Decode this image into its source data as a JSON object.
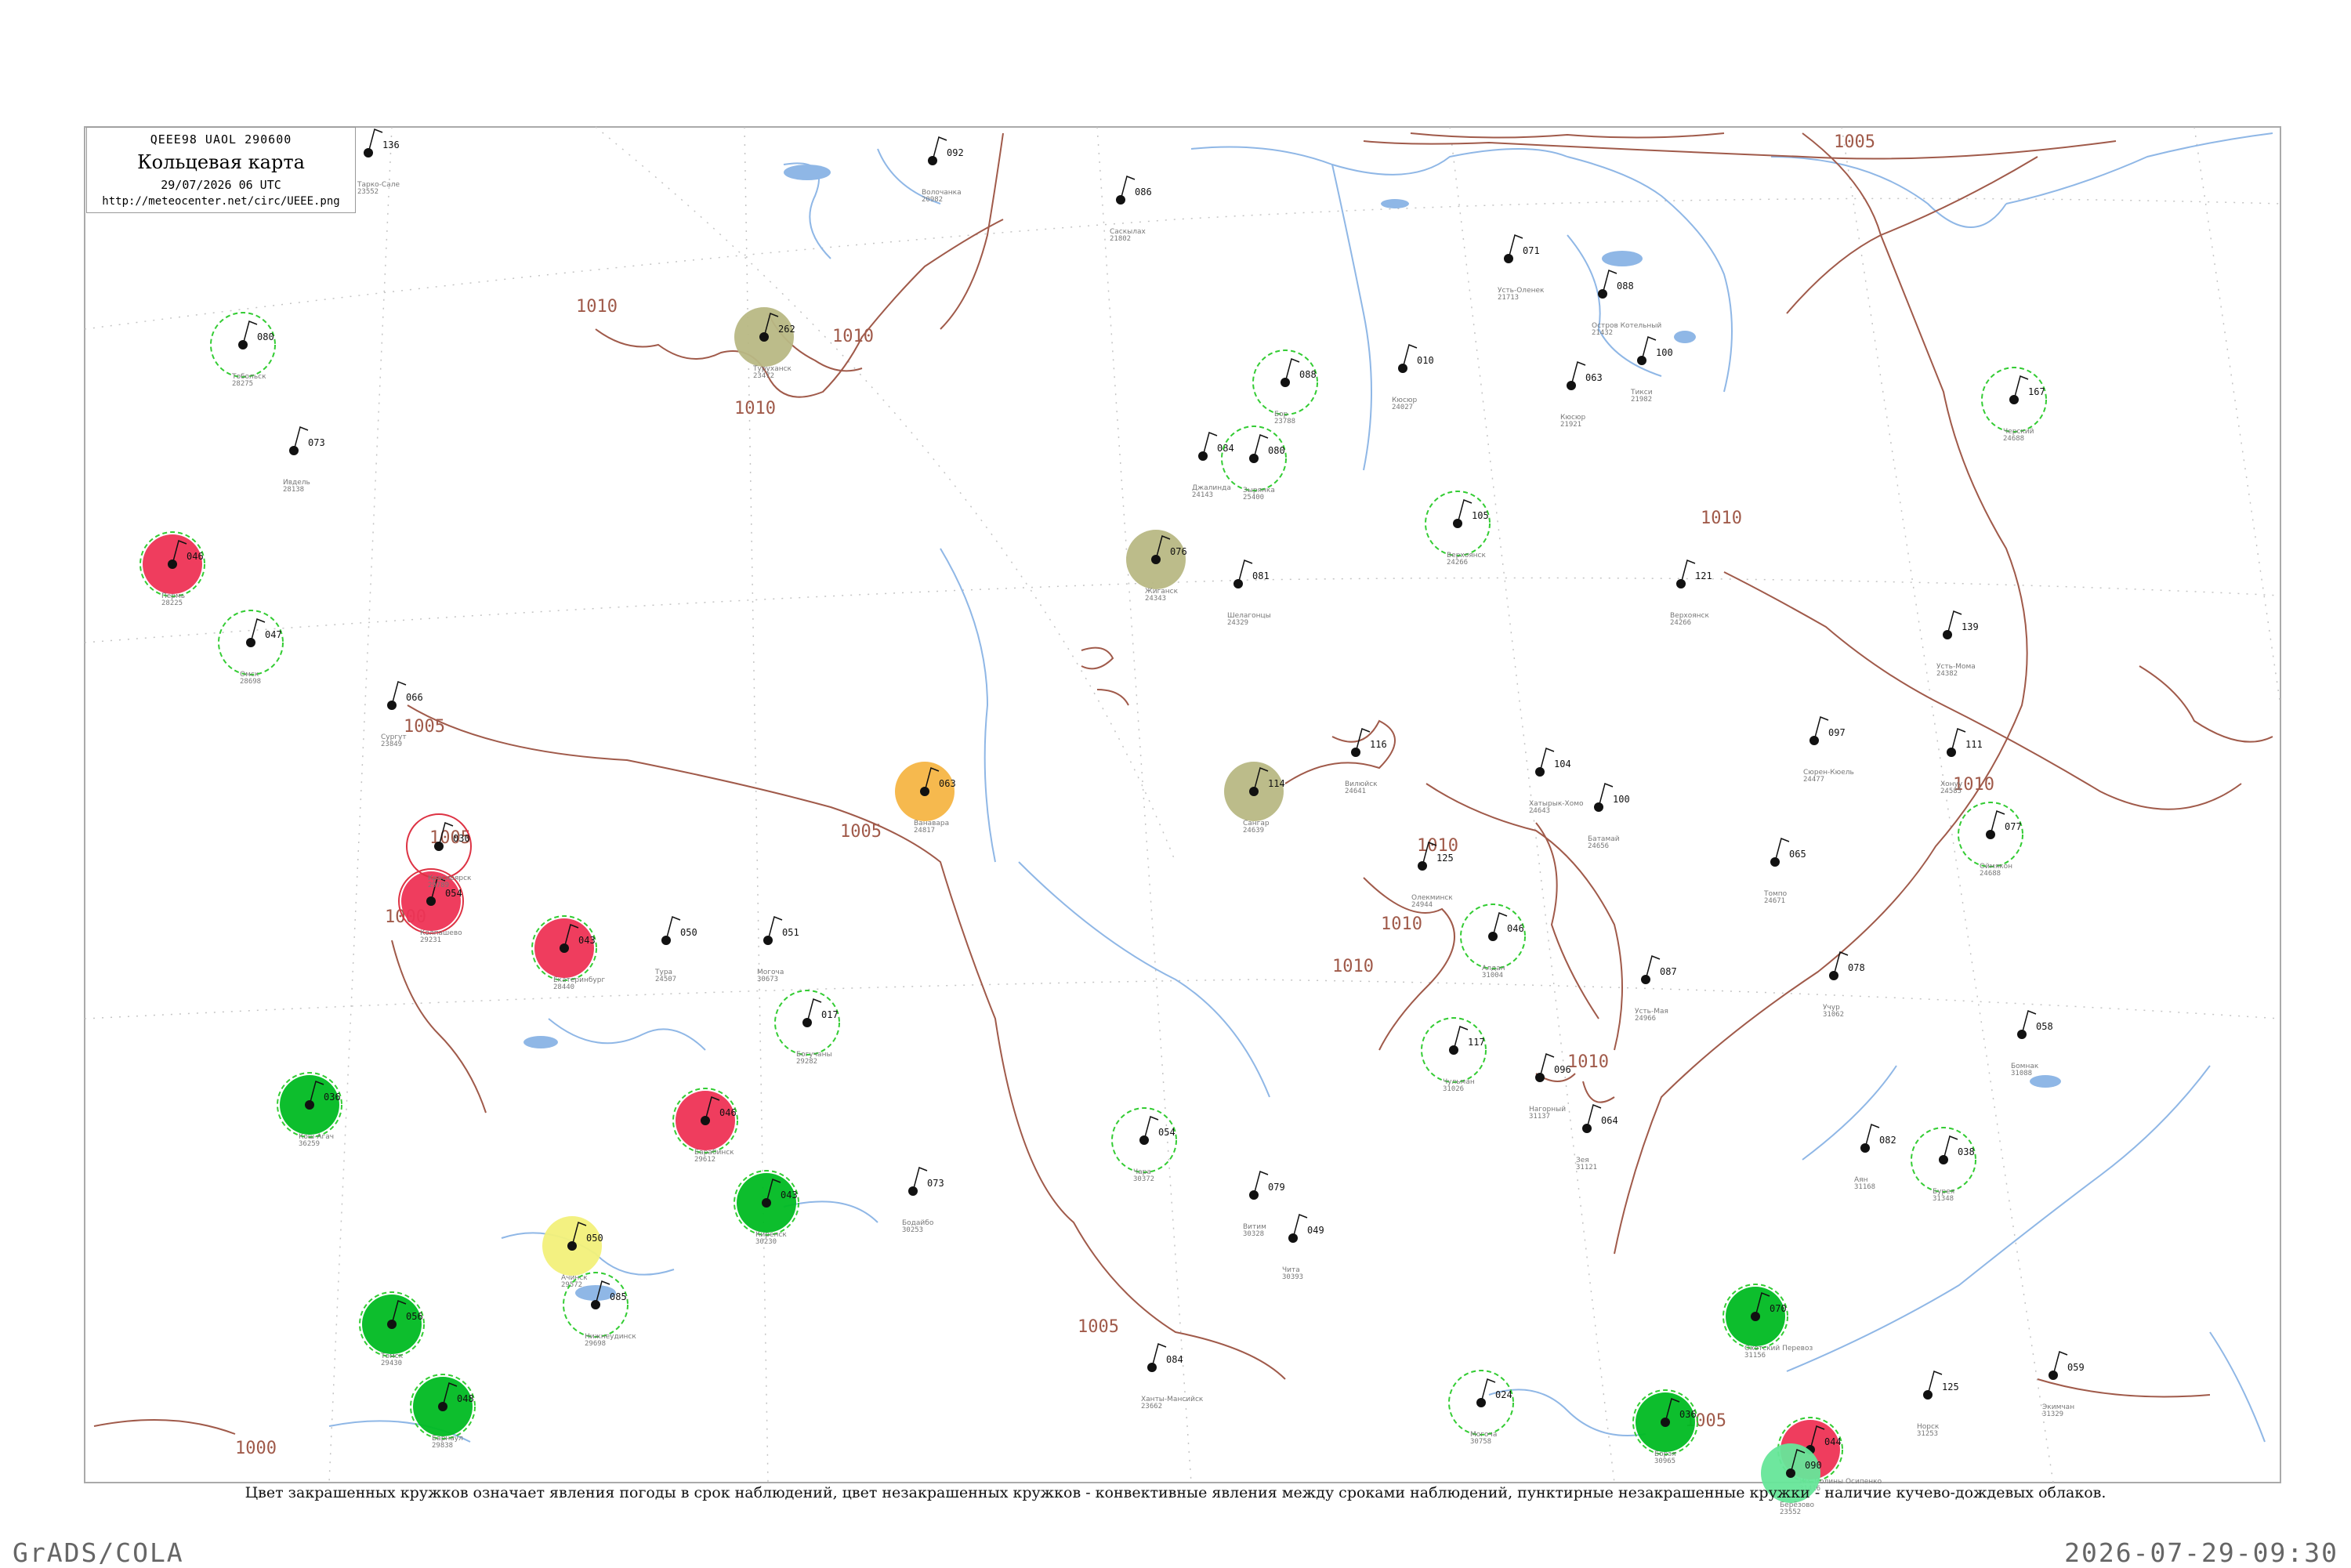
{
  "header": {
    "line1": "QEEE98  UAOL  290600",
    "title": "Кольцевая карта",
    "datetime": "29/07/2026 06 UTC",
    "url": "http://meteocenter.net/circ/UEEE.png"
  },
  "caption": "Цвет закрашенных кружков означает явления погоды в срок наблюдений, цвет незакрашенных кружков - конвективные явления между сроками наблюдений, пунктирные незакрашенные кружки - наличие кучево-дождевых облаков.",
  "footer": {
    "left": "GrADS/COLA",
    "right": "2026-07-29-09:30"
  },
  "colors": {
    "isobar": "#a05a4a",
    "water": "#8fb7e6",
    "grid": "#bbbbbb",
    "fill_green": "#00bb22",
    "fill_red": "#ee3355",
    "fill_olive": "#b8b884",
    "fill_orange": "#f5b545",
    "fill_yellow": "#f2f07a",
    "fill_lightgreen": "#66e699",
    "dashed_green": "#33cc33",
    "solid_red": "#dd3344"
  },
  "isobar_labels": [
    "1005",
    "1010",
    "1010",
    "1010",
    "1005",
    "1005",
    "1010",
    "1010",
    "1010",
    "1010",
    "1010",
    "1005",
    "1010",
    "1000",
    "1005",
    "1005",
    "1000"
  ],
  "stations": [
    {
      "p": "136",
      "id": "23552",
      "name": "Тарко-Сале",
      "ring": "none",
      "fill": "none"
    },
    {
      "p": "262",
      "id": "23472",
      "name": "Туруханск",
      "ring": "none",
      "fill": "olive"
    },
    {
      "p": "092",
      "id": "20982",
      "name": "Волочанка",
      "ring": "none",
      "fill": "none"
    },
    {
      "p": "086",
      "id": "21802",
      "name": "Саскылах",
      "ring": "none",
      "fill": "none"
    },
    {
      "p": "071",
      "id": "21713",
      "name": "Усть-Оленек",
      "ring": "none",
      "fill": "none"
    },
    {
      "p": "088",
      "id": "21432",
      "name": "Остров Котельный",
      "ring": "none",
      "fill": "none"
    },
    {
      "p": "084",
      "id": "24143",
      "name": "Джалинда",
      "ring": "none",
      "fill": "none"
    },
    {
      "p": "010",
      "id": "24027",
      "name": "Кюсюр",
      "ring": "none",
      "fill": "none"
    },
    {
      "p": "063",
      "id": "21921",
      "name": "Кюсюр",
      "ring": "none",
      "fill": "none"
    },
    {
      "p": "100",
      "id": "21982",
      "name": "Тикси",
      "ring": "none",
      "fill": "none"
    },
    {
      "p": "167",
      "id": "24688",
      "name": "Черский",
      "ring": "dashed",
      "fill": "none"
    },
    {
      "p": "088",
      "id": "23788",
      "name": "Бор",
      "ring": "dashed",
      "fill": "none"
    },
    {
      "p": "080",
      "id": "25400",
      "name": "Зырянка",
      "ring": "dashed",
      "fill": "none"
    },
    {
      "p": "105",
      "id": "24266",
      "name": "Верхоянск",
      "ring": "dashed",
      "fill": "none"
    },
    {
      "p": "076",
      "id": "24343",
      "name": "Жиганск",
      "ring": "none",
      "fill": "olive"
    },
    {
      "p": "081",
      "id": "24329",
      "name": "Шелагонцы",
      "ring": "none",
      "fill": "none"
    },
    {
      "p": "121",
      "id": "24266",
      "name": "Верхоянск",
      "ring": "none",
      "fill": "none"
    },
    {
      "p": "139",
      "id": "24382",
      "name": "Усть-Мома",
      "ring": "none",
      "fill": "none"
    },
    {
      "p": "114",
      "id": "24639",
      "name": "Сангар",
      "ring": "none",
      "fill": "olive"
    },
    {
      "p": "063",
      "id": "24817",
      "name": "Ванавара",
      "ring": "none",
      "fill": "orange"
    },
    {
      "p": "097",
      "id": "24477",
      "name": "Сюрен-Кюель",
      "ring": "none",
      "fill": "none"
    },
    {
      "p": "111",
      "id": "24585",
      "name": "Хонуу",
      "ring": "none",
      "fill": "none"
    },
    {
      "p": "077",
      "id": "24688",
      "name": "Оймякон",
      "ring": "dashed",
      "fill": "none"
    },
    {
      "p": "116",
      "id": "24641",
      "name": "Вилюйск",
      "ring": "none",
      "fill": "none"
    },
    {
      "p": "104",
      "id": "24643",
      "name": "Хатырык-Хомо",
      "ring": "none",
      "fill": "none"
    },
    {
      "p": "100",
      "id": "24656",
      "name": "Батамай",
      "ring": "none",
      "fill": "none"
    },
    {
      "p": "065",
      "id": "24671",
      "name": "Томпо",
      "ring": "none",
      "fill": "none"
    },
    {
      "p": "125",
      "id": "24944",
      "name": "Олекминск",
      "ring": "none",
      "fill": "none"
    },
    {
      "p": "046",
      "id": "31004",
      "name": "Алдан",
      "ring": "dashed",
      "fill": "none"
    },
    {
      "p": "087",
      "id": "24966",
      "name": "Усть-Мая",
      "ring": "none",
      "fill": "none"
    },
    {
      "p": "078",
      "id": "31062",
      "name": "Учур",
      "ring": "none",
      "fill": "none"
    },
    {
      "p": "117",
      "id": "31026",
      "name": "Чульман",
      "ring": "dashed",
      "fill": "none"
    },
    {
      "p": "096",
      "id": "31137",
      "name": "Нагорный",
      "ring": "none",
      "fill": "none"
    },
    {
      "p": "064",
      "id": "31121",
      "name": "Зея",
      "ring": "none",
      "fill": "none"
    },
    {
      "p": "082",
      "id": "31168",
      "name": "Аян",
      "ring": "none",
      "fill": "none"
    },
    {
      "p": "070",
      "id": "31156",
      "name": "Охотский Перевоз",
      "ring": "dashed",
      "fill": "green"
    },
    {
      "p": "058",
      "id": "31088",
      "name": "Бомнак",
      "ring": "none",
      "fill": "none"
    },
    {
      "p": "059",
      "id": "31329",
      "name": "Экимчан",
      "ring": "none",
      "fill": "none"
    },
    {
      "p": "044",
      "id": "31416",
      "name": "Им. Полины Осипенко",
      "ring": "dashed",
      "fill": "red"
    },
    {
      "p": "038",
      "id": "31348",
      "name": "Бурея",
      "ring": "dashed",
      "fill": "none"
    },
    {
      "p": "125",
      "id": "31253",
      "name": "Норск",
      "ring": "none",
      "fill": "none"
    },
    {
      "p": "050",
      "id": "29572",
      "name": "Ачинск",
      "ring": "none",
      "fill": "yellow"
    },
    {
      "p": "085",
      "id": "29698",
      "name": "Нижнеудинск",
      "ring": "dashed",
      "fill": "none"
    },
    {
      "p": "043",
      "id": "30230",
      "name": "Киренск",
      "ring": "dashed",
      "fill": "green"
    },
    {
      "p": "079",
      "id": "30328",
      "name": "Витим",
      "ring": "none",
      "fill": "none"
    },
    {
      "p": "054",
      "id": "30372",
      "name": "Чара",
      "ring": "dashed",
      "fill": "none"
    },
    {
      "p": "073",
      "id": "30253",
      "name": "Бодайбо",
      "ring": "none",
      "fill": "none"
    },
    {
      "p": "049",
      "id": "30393",
      "name": "Чита",
      "ring": "none",
      "fill": "none"
    },
    {
      "p": "024",
      "id": "30758",
      "name": "Могоча",
      "ring": "dashed",
      "fill": "none"
    },
    {
      "p": "036",
      "id": "30965",
      "name": "Борзя",
      "ring": "dashed",
      "fill": "green"
    },
    {
      "p": "066",
      "id": "23849",
      "name": "Сургут",
      "ring": "none",
      "fill": "none"
    },
    {
      "p": "046",
      "id": "28225",
      "name": "Пермь",
      "ring": "dashed",
      "fill": "red"
    },
    {
      "p": "043",
      "id": "28440",
      "name": "Екатеринбург",
      "ring": "dashed",
      "fill": "red"
    },
    {
      "p": "054",
      "id": "29231",
      "name": "Колпашево",
      "ring": "solid",
      "fill": "red"
    },
    {
      "p": "056",
      "id": "29430",
      "name": "Томск",
      "ring": "dashed",
      "fill": "green"
    },
    {
      "p": "048",
      "id": "29838",
      "name": "Барнаул",
      "ring": "dashed",
      "fill": "green"
    },
    {
      "p": "036",
      "id": "36259",
      "name": "Кош-Агач",
      "ring": "dashed",
      "fill": "green"
    },
    {
      "p": "046",
      "id": "29612",
      "name": "Барабинск",
      "ring": "dashed",
      "fill": "red"
    },
    {
      "p": "017",
      "id": "29282",
      "name": "Богучаны",
      "ring": "dashed",
      "fill": "none"
    },
    {
      "p": "030",
      "id": "29789",
      "name": "Красноярск",
      "ring": "solid",
      "fill": "none"
    },
    {
      "p": "047",
      "id": "28698",
      "name": "Омск",
      "ring": "dashed",
      "fill": "none"
    },
    {
      "p": "080",
      "id": "28275",
      "name": "Тобольск",
      "ring": "dashed",
      "fill": "none"
    },
    {
      "p": "073",
      "id": "28138",
      "name": "Ивдель",
      "ring": "none",
      "fill": "none"
    },
    {
      "p": "090",
      "id": "23552",
      "name": "Берёзово",
      "ring": "none",
      "fill": "lightgreen"
    },
    {
      "p": "084",
      "id": "23662",
      "name": "Ханты-Мансийск",
      "ring": "none",
      "fill": "none"
    },
    {
      "p": "050",
      "id": "24507",
      "name": "Тура",
      "ring": "none",
      "fill": "none"
    },
    {
      "p": "051",
      "id": "30673",
      "name": "Могоча",
      "ring": "none",
      "fill": "none"
    }
  ]
}
